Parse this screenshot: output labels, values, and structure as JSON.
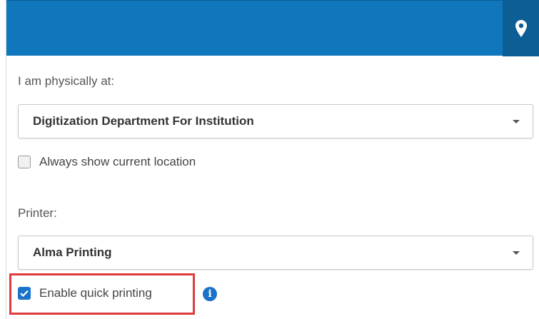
{
  "location": {
    "label": "I am physically at:",
    "selected": "Digitization Department For Institution",
    "always_show": {
      "label": "Always show current location",
      "checked": false
    }
  },
  "printer": {
    "label": "Printer:",
    "selected": "Alma Printing",
    "quick_printing": {
      "label": "Enable quick printing",
      "checked": true
    }
  },
  "icons": {
    "header_button": "map-marker-icon",
    "dropdown": "caret-down-icon",
    "help": "info-icon"
  },
  "colors": {
    "header": "#1177bd",
    "header_button": "#0d5e94",
    "highlight": "#e03b3b",
    "checkbox_checked": "#1a73c8"
  }
}
